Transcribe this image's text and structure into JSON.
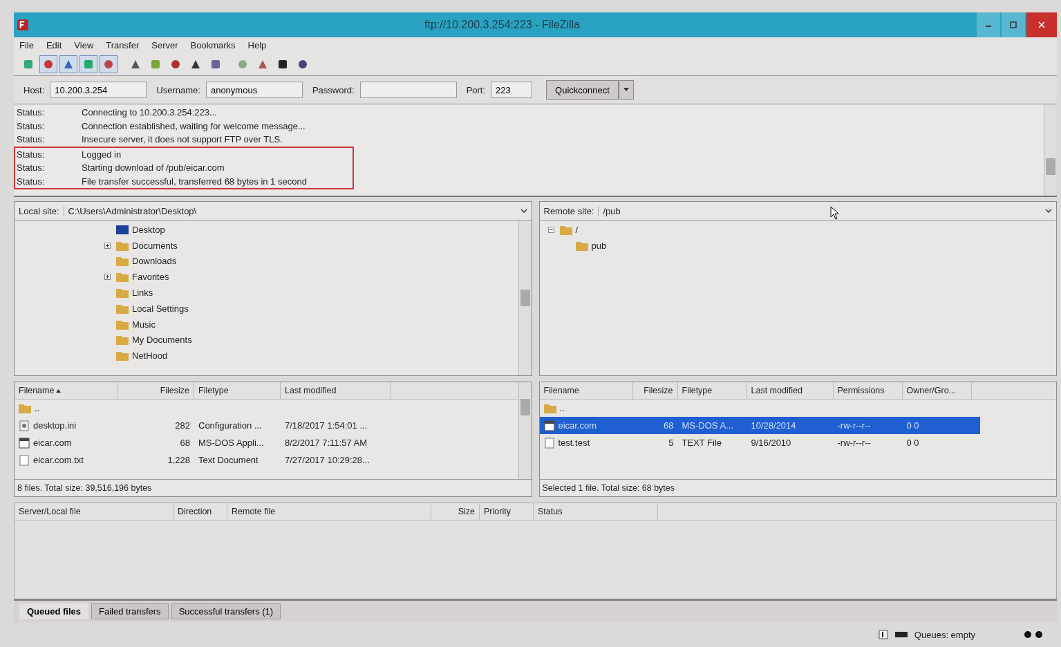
{
  "window": {
    "title": "ftp://10.200.3.254:223 - FileZilla"
  },
  "menu": [
    "File",
    "Edit",
    "View",
    "Transfer",
    "Server",
    "Bookmarks",
    "Help"
  ],
  "toolbar": [
    {
      "pressed": false
    },
    {
      "pressed": true
    },
    {
      "pressed": true
    },
    {
      "pressed": true
    },
    {
      "pressed": true
    },
    {
      "pressed": false
    },
    {
      "pressed": false
    },
    {
      "pressed": false
    },
    {
      "pressed": false
    },
    {
      "pressed": false
    },
    {
      "pressed": false
    },
    {
      "pressed": false
    },
    {
      "pressed": false
    },
    {
      "pressed": false
    }
  ],
  "quickconnect": {
    "host_label": "Host:",
    "host": "10.200.3.254",
    "username_label": "Username:",
    "username": "anonymous",
    "password_label": "Password:",
    "port_label": "Port:",
    "port": "223",
    "button": "Quickconnect"
  },
  "log": [
    {
      "label": "Status:",
      "message": "Connecting to 10.200.3.254:223...",
      "highlighted": false
    },
    {
      "label": "Status:",
      "message": "Connection established, waiting for welcome message...",
      "highlighted": false
    },
    {
      "label": "Status:",
      "message": "Insecure server, it does not support FTP over TLS.",
      "highlighted": false
    },
    {
      "label": "Status:",
      "message": "Logged in",
      "highlighted": true
    },
    {
      "label": "Status:",
      "message": "Starting download of /pub/eicar.com",
      "highlighted": true
    },
    {
      "label": "Status:",
      "message": "File transfer successful, transferred 68 bytes in 1 second",
      "highlighted": true
    }
  ],
  "local_site": {
    "label": "Local site:",
    "path": "C:\\Users\\Administrator\\Desktop\\",
    "tree": [
      {
        "name": "Desktop",
        "expandable": false,
        "kind": "desktop"
      },
      {
        "name": "Documents",
        "expandable": true,
        "kind": "folder"
      },
      {
        "name": "Downloads",
        "expandable": false,
        "kind": "folder"
      },
      {
        "name": "Favorites",
        "expandable": true,
        "kind": "folder"
      },
      {
        "name": "Links",
        "expandable": false,
        "kind": "folder"
      },
      {
        "name": "Local Settings",
        "expandable": false,
        "kind": "folder"
      },
      {
        "name": "Music",
        "expandable": false,
        "kind": "folder"
      },
      {
        "name": "My Documents",
        "expandable": false,
        "kind": "folder"
      },
      {
        "name": "NetHood",
        "expandable": false,
        "kind": "folder"
      }
    ]
  },
  "remote_site": {
    "label": "Remote site:",
    "path": "/pub",
    "tree": [
      {
        "name": "/",
        "expanded": true,
        "children": [
          {
            "name": "pub"
          }
        ]
      }
    ]
  },
  "local_files": {
    "columns": [
      {
        "label": "Filename",
        "sorted": true
      },
      {
        "label": "Filesize",
        "sorted": false
      },
      {
        "label": "Filetype",
        "sorted": false
      },
      {
        "label": "Last modified",
        "sorted": false
      }
    ],
    "rows": [
      {
        "kind": "folder",
        "cells": [
          "..",
          "",
          "",
          ""
        ],
        "selected": false
      },
      {
        "kind": "config",
        "cells": [
          "desktop.ini",
          "282",
          "Configuration ...",
          "7/18/2017 1:54:01 ..."
        ],
        "selected": false
      },
      {
        "kind": "app",
        "cells": [
          "eicar.com",
          "68",
          "MS-DOS Appli...",
          "8/2/2017 7:11:57 AM"
        ],
        "selected": false
      },
      {
        "kind": "text",
        "cells": [
          "eicar.com.txt",
          "1,228",
          "Text Document",
          "7/27/2017 10:29:28..."
        ],
        "selected": false
      }
    ],
    "status": "8 files. Total size: 39,516,196 bytes"
  },
  "remote_files": {
    "columns": [
      "Filename",
      "Filesize",
      "Filetype",
      "Last modified",
      "Permissions",
      "Owner/Gro..."
    ],
    "rows": [
      {
        "kind": "folder",
        "cells": [
          "..",
          "",
          "",
          "",
          "",
          ""
        ],
        "selected": false
      },
      {
        "kind": "app",
        "cells": [
          "eicar.com",
          "68",
          "MS-DOS A...",
          "10/28/2014",
          "-rw-r--r--",
          "0 0"
        ],
        "selected": true
      },
      {
        "kind": "text",
        "cells": [
          "test.test",
          "5",
          "TEXT File",
          "9/16/2010",
          "-rw-r--r--",
          "0 0"
        ],
        "selected": false
      }
    ],
    "status": "Selected 1 file. Total size: 68 bytes"
  },
  "queue": {
    "columns": [
      "Server/Local file",
      "Direction",
      "Remote file",
      "Size",
      "Priority",
      "Status"
    ]
  },
  "queue_tabs": [
    {
      "label": "Queued files",
      "selected": true
    },
    {
      "label": "Failed transfers",
      "selected": false
    },
    {
      "label": "Successful transfers (1)",
      "selected": false
    }
  ],
  "status_bar": {
    "queue": "Queues: empty"
  }
}
